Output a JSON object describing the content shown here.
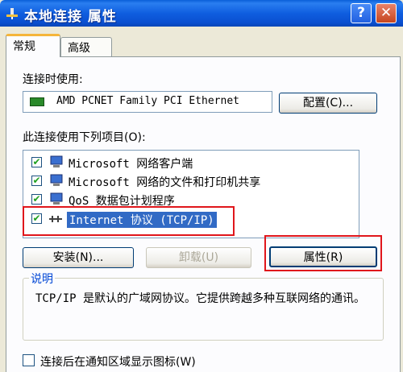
{
  "window": {
    "title": "本地连接 属性",
    "help_label": "?",
    "close_label": "✕"
  },
  "tabs": [
    {
      "label": "常规",
      "active": true
    },
    {
      "label": "高级",
      "active": false
    }
  ],
  "connect_using": {
    "label": "连接时使用:",
    "adapter": "AMD PCNET Family PCI Ethernet",
    "configure_button": "配置(C)..."
  },
  "items_section": {
    "label": "此连接使用下列项目(O):",
    "items": [
      {
        "label": "Microsoft 网络客户端",
        "checked": true,
        "icon": "network-client-icon"
      },
      {
        "label": "Microsoft 网络的文件和打印机共享",
        "checked": true,
        "icon": "file-printer-sharing-icon"
      },
      {
        "label": "QoS 数据包计划程序",
        "checked": true,
        "icon": "qos-scheduler-icon"
      },
      {
        "label": "Internet 协议 (TCP/IP)",
        "checked": true,
        "icon": "protocol-icon",
        "selected": true
      }
    ]
  },
  "buttons": {
    "install": "安装(N)...",
    "uninstall": "卸载(U)",
    "properties": "属性(R)"
  },
  "description": {
    "legend": "说明",
    "text": "TCP/IP 是默认的广域网协议。它提供跨越多种互联网络的通讯。"
  },
  "notify_option": {
    "label": "连接后在通知区域显示图标(W)",
    "checked": false
  },
  "colors": {
    "title_bar": "#0a5fd8",
    "highlight_box": "#e0161b",
    "selection": "#316ac5"
  }
}
